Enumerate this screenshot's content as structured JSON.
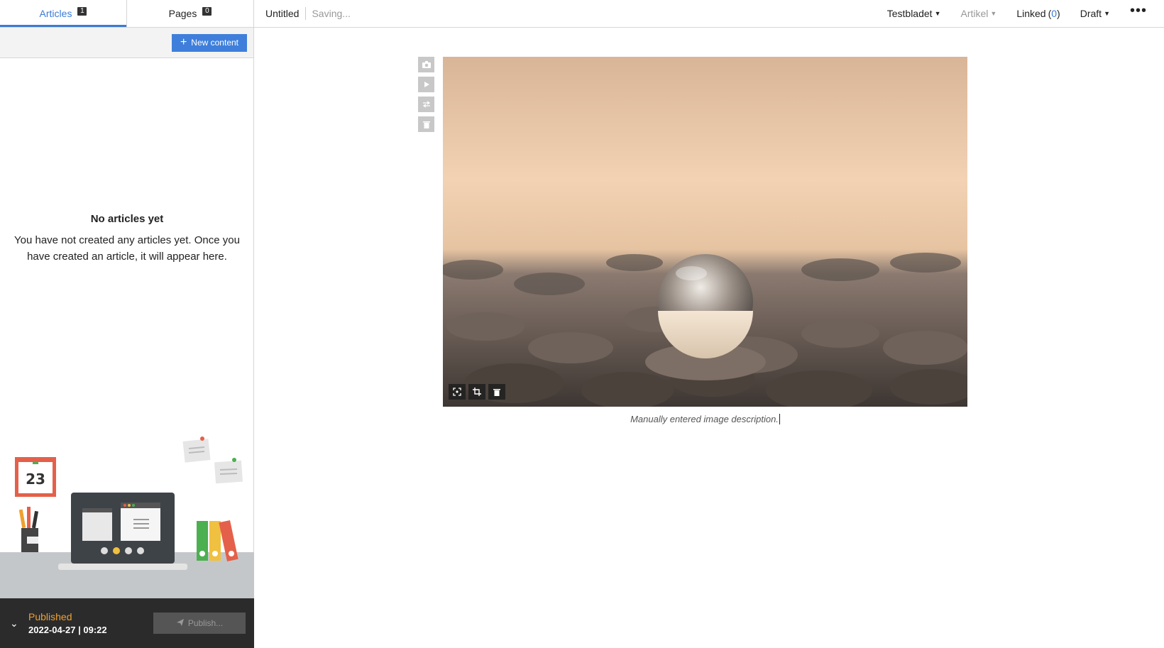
{
  "sidebar": {
    "tabs": [
      {
        "label": "Articles",
        "count": "1"
      },
      {
        "label": "Pages",
        "count": "0"
      }
    ],
    "new_content_label": "New content",
    "empty_title": "No articles yet",
    "empty_text": "You have not created any articles yet. Once you have created an article, it will appear here.",
    "illustration": {
      "calendar_day": "23"
    }
  },
  "publish_bar": {
    "status": "Published",
    "date": "2022-04-27 | 09:22",
    "publish_label": "Publish..."
  },
  "header": {
    "title": "Untitled",
    "save_state": "Saving...",
    "publication_menu": "Testbladet",
    "type_menu": "Artikel",
    "linked_label": "Linked",
    "linked_count": "0",
    "status_menu": "Draft"
  },
  "editor": {
    "caption": "Manually entered image description."
  },
  "colors": {
    "accent": "#3a7bd5",
    "published": "#f0a030",
    "bottombar": "#2b2b2b"
  }
}
